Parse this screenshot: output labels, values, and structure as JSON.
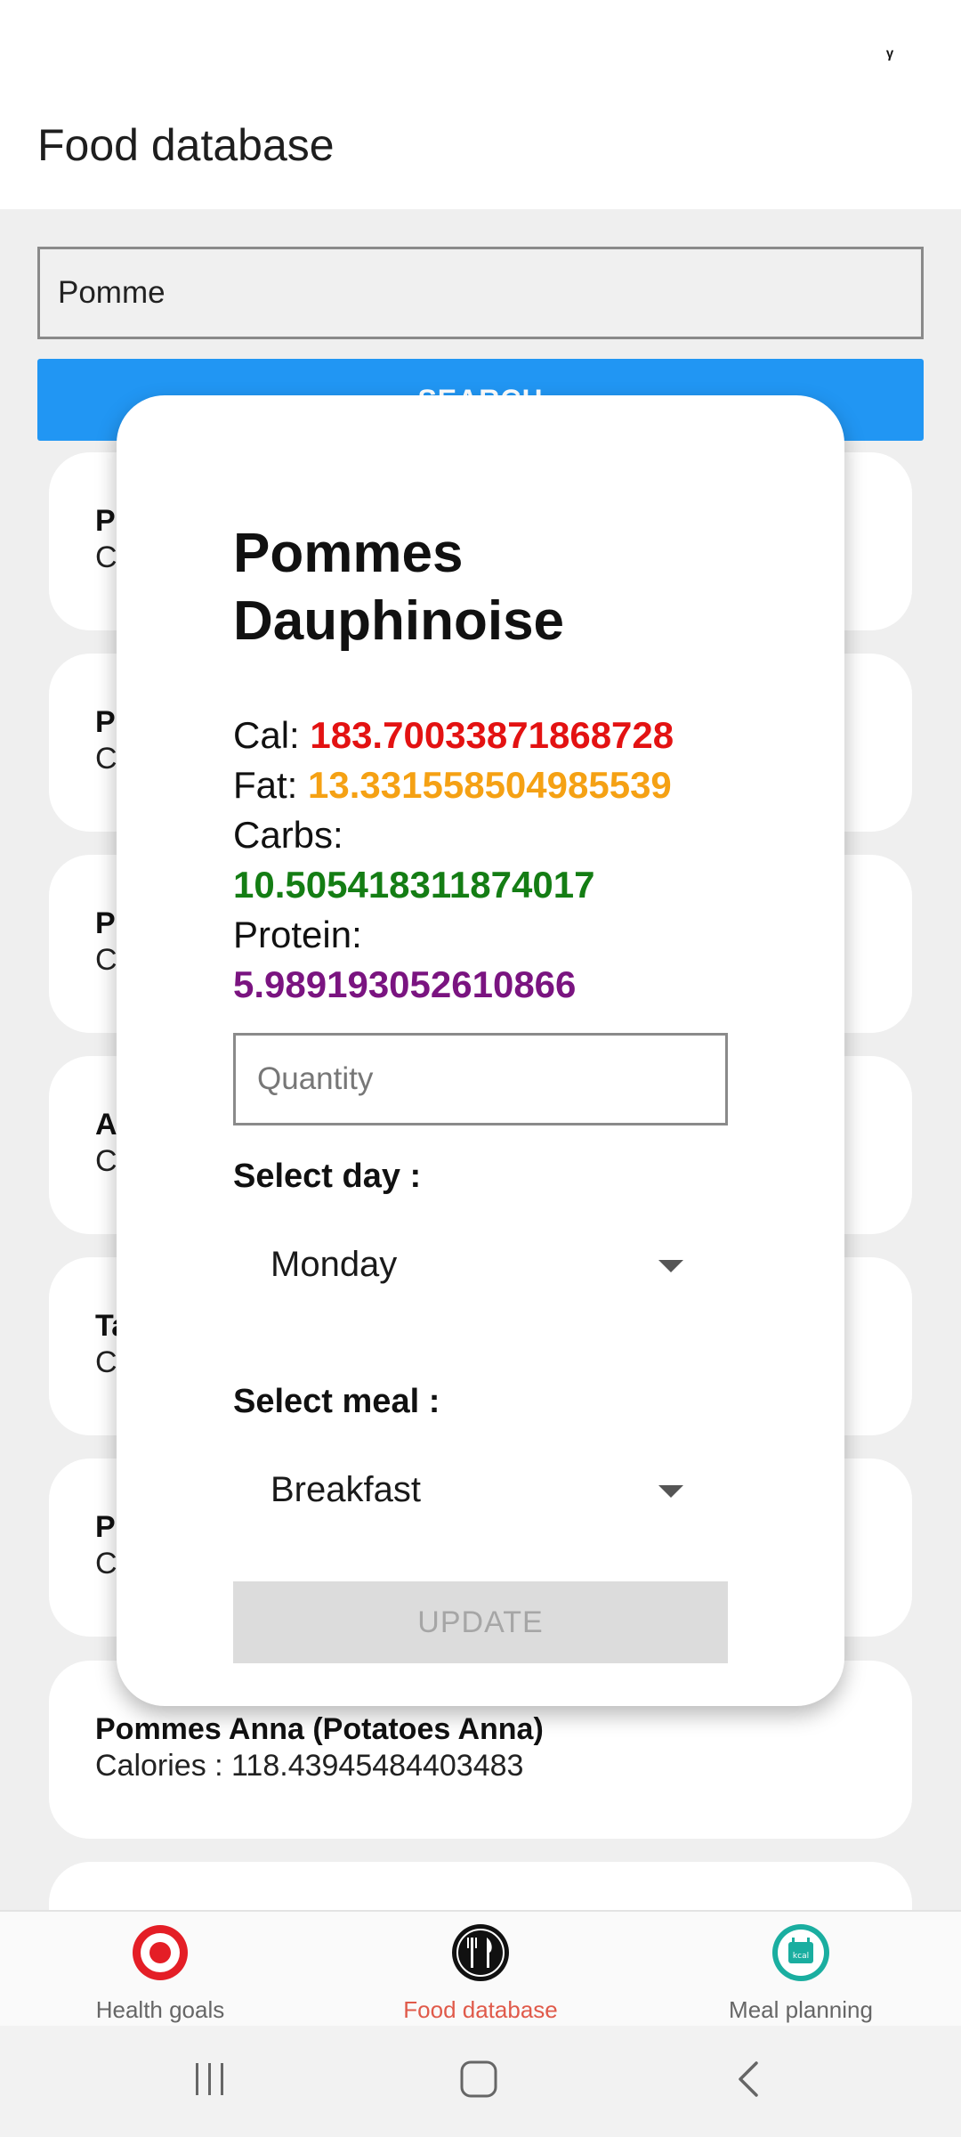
{
  "status_bar": {
    "glyph": "ᵞ"
  },
  "app_bar": {
    "title": "Food database"
  },
  "search": {
    "value": "Pomme",
    "button_label": "SEARCH"
  },
  "results": [
    {
      "name": "P",
      "calories": "C"
    },
    {
      "name": "P",
      "calories": "C"
    },
    {
      "name": "P",
      "calories": "C"
    },
    {
      "name": "A",
      "calories": "C"
    },
    {
      "name": "Ta",
      "calories": "C"
    },
    {
      "name": "P",
      "calories": "C"
    },
    {
      "name": "Pommes Anna (Potatoes Anna)",
      "calories": "Calories : 118.43945484403483"
    }
  ],
  "dialog": {
    "title": "Pommes Dauphinoise",
    "cal_label": "Cal: ",
    "cal_value": "183.70033871868728",
    "fat_label": "Fat: ",
    "fat_value": "13.331558504985539",
    "carbs_label": "Carbs:",
    "carbs_value": "10.505418311874017",
    "protein_label": "Protein:",
    "protein_value": "5.989193052610866",
    "quantity_placeholder": "Quantity",
    "day_label": "Select day :",
    "day_value": "Monday",
    "meal_label": "Select meal :",
    "meal_value": "Breakfast",
    "update_label": "UPDATE"
  },
  "bottom_nav": {
    "items": [
      {
        "label": "Health goals",
        "icon": "target-icon",
        "active": false
      },
      {
        "label": "Food database",
        "icon": "fork-knife-icon",
        "active": true
      },
      {
        "label": "Meal planning",
        "icon": "kcal-calendar-icon",
        "active": false
      }
    ]
  },
  "colors": {
    "accent_blue": "#2196f3",
    "active_nav": "#e05a4a",
    "cal": "#e31212",
    "fat": "#f5a114",
    "carbs": "#147d14",
    "protein": "#7a1480"
  }
}
